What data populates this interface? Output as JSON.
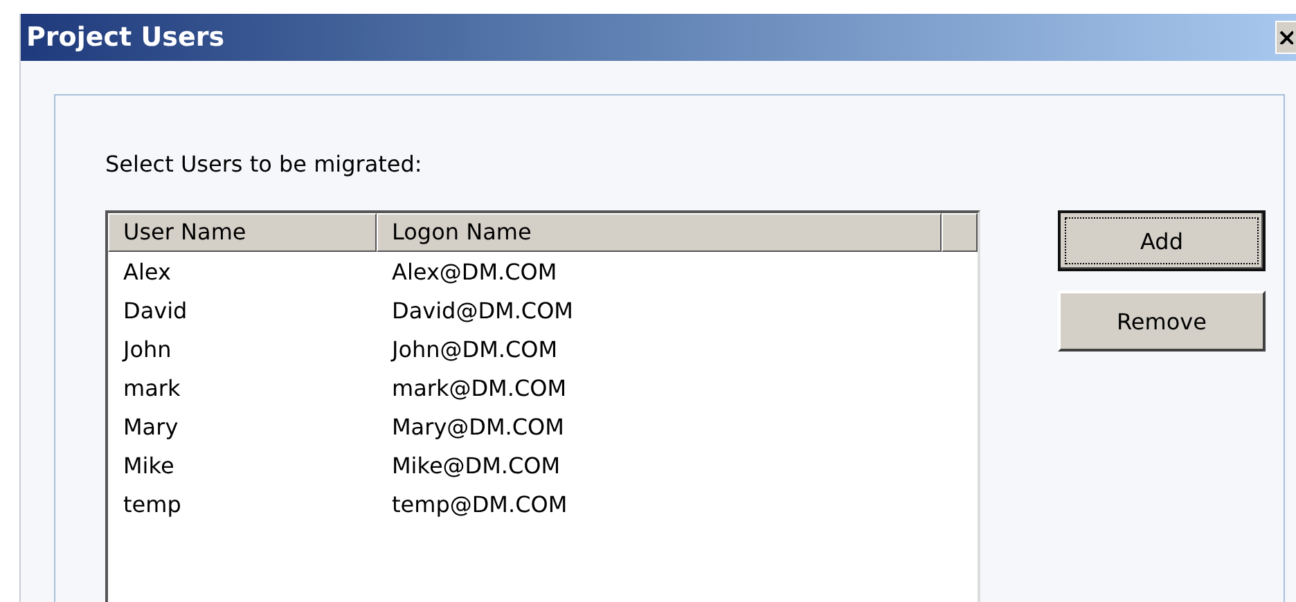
{
  "window": {
    "title": "Project Users"
  },
  "prompt": "Select Users to be migrated:",
  "table": {
    "columns": [
      "User Name",
      "Logon Name"
    ],
    "rows": [
      [
        "Alex",
        "Alex@DM.COM"
      ],
      [
        "David",
        "David@DM.COM"
      ],
      [
        "John",
        "John@DM.COM"
      ],
      [
        "mark",
        "mark@DM.COM"
      ],
      [
        "Mary",
        "Mary@DM.COM"
      ],
      [
        "Mike",
        "Mike@DM.COM"
      ],
      [
        "temp",
        "temp@DM.COM"
      ]
    ]
  },
  "buttons": [
    {
      "label": "Add",
      "focused": true
    },
    {
      "label": "Remove",
      "focused": false
    }
  ]
}
